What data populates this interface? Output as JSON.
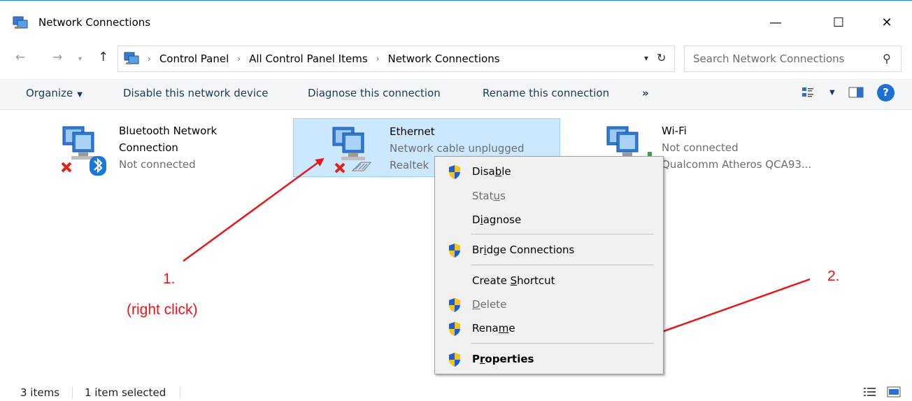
{
  "window": {
    "title": "Network Connections",
    "controls": {
      "minimize": "—",
      "maximize": "☐",
      "close": "✕"
    }
  },
  "address": {
    "crumbs": [
      "Control Panel",
      "All Control Panel Items",
      "Network Connections"
    ],
    "separator": "›"
  },
  "search": {
    "placeholder": "Search Network Connections"
  },
  "commands": {
    "organize": "Organize",
    "disable": "Disable this network device",
    "diagnose": "Diagnose this connection",
    "rename": "Rename this connection",
    "more": "»",
    "help": "?"
  },
  "items": [
    {
      "name_line1": "Bluetooth Network",
      "name_line2": "Connection",
      "status": "Not connected"
    },
    {
      "name": "Ethernet",
      "status": "Network cable unplugged",
      "device": "Realtek"
    },
    {
      "name": "Wi-Fi",
      "status": "Not connected",
      "device": "Qualcomm Atheros QCA93..."
    }
  ],
  "context_menu": {
    "disable": {
      "pre": "Disa",
      "key": "b",
      "post": "le"
    },
    "status": {
      "pre": "Stat",
      "key": "u",
      "post": "s"
    },
    "diagnose": {
      "pre": "D",
      "key": "i",
      "post": "agnose"
    },
    "bridge": {
      "pre": "Br",
      "key": "i",
      "post": "dge Connections"
    },
    "shortcut": {
      "pre": "Create ",
      "key": "S",
      "post": "hortcut"
    },
    "delete": {
      "pre": "",
      "key": "D",
      "post": "elete"
    },
    "rename": {
      "pre": "Rena",
      "key": "m",
      "post": "e"
    },
    "properties": {
      "pre": "P",
      "key": "r",
      "post": "operties"
    }
  },
  "annotations": {
    "step1": "1.",
    "step1_note": "(right click)",
    "step2": "2."
  },
  "status_bar": {
    "count": "3 items",
    "selected": "1 item selected"
  },
  "colors": {
    "annotation": "#e8161a",
    "selection": "#cce8ff",
    "shield_blue": "#1f5bd6",
    "shield_yellow": "#f5c518"
  }
}
